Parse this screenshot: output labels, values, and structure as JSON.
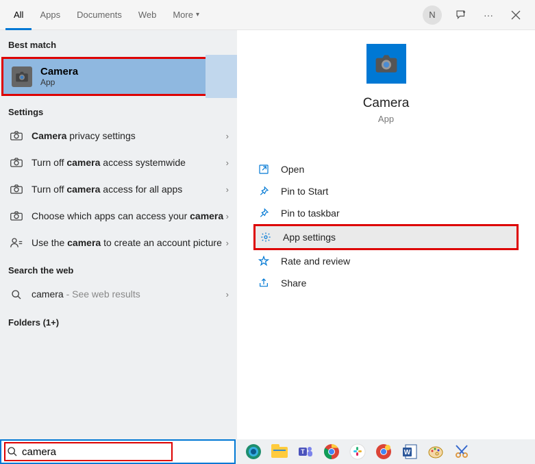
{
  "tabs": [
    "All",
    "Apps",
    "Documents",
    "Web",
    "More"
  ],
  "tabs_more_caret": "▾",
  "avatar": "N",
  "section_bestmatch": "Best match",
  "bestmatch": {
    "title": "Camera",
    "sub": "App"
  },
  "section_settings": "Settings",
  "settings": [
    {
      "html": "<b>Camera</b> privacy settings"
    },
    {
      "html": "Turn off <b>camera</b> access systemwide"
    },
    {
      "html": "Turn off <b>camera</b> access for all apps"
    },
    {
      "html": "Choose which apps can access your <b>camera</b>"
    },
    {
      "html": "Use the <b>camera</b> to create an account picture"
    }
  ],
  "section_web": "Search the web",
  "web": {
    "term": "camera",
    "suffix": " - See web results"
  },
  "section_folders": "Folders (1+)",
  "detail": {
    "title": "Camera",
    "sub": "App"
  },
  "actions": [
    {
      "icon": "open",
      "label": "Open"
    },
    {
      "icon": "pin-start",
      "label": "Pin to Start"
    },
    {
      "icon": "pin-taskbar",
      "label": "Pin to taskbar"
    },
    {
      "icon": "settings",
      "label": "App settings",
      "highlight": true
    },
    {
      "icon": "star",
      "label": "Rate and review"
    },
    {
      "icon": "share",
      "label": "Share"
    }
  ],
  "search_value": "camera"
}
